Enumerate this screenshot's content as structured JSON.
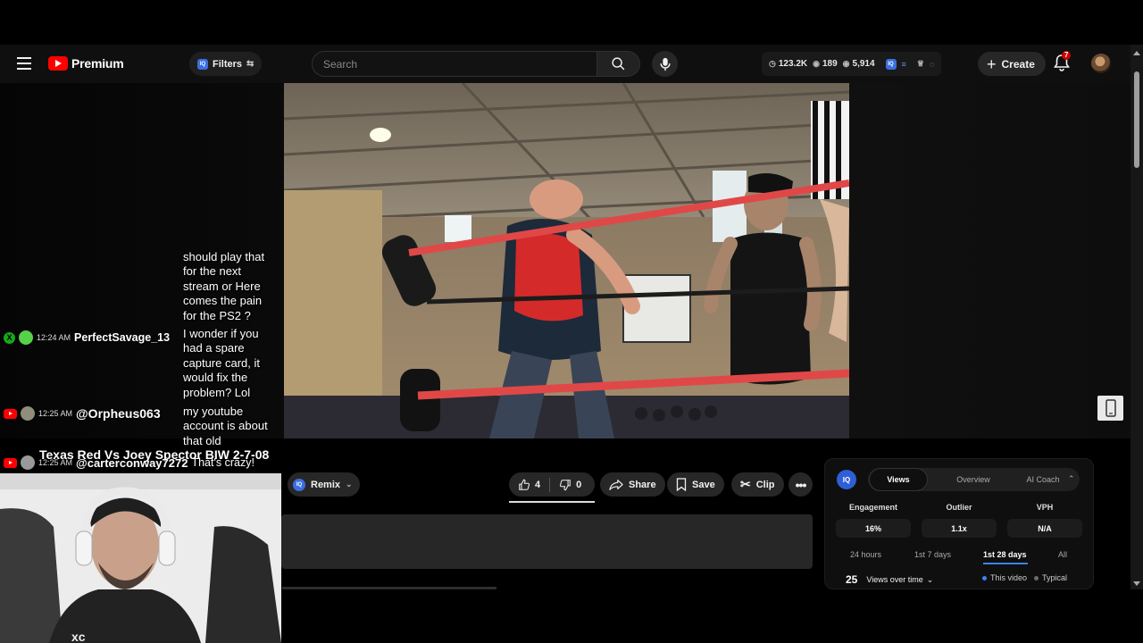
{
  "header": {
    "logo_text": "Premium",
    "filters_label": "Filters",
    "search_placeholder": "Search",
    "stats": {
      "views": "123.2K",
      "likes": "189",
      "watching": "5,914"
    },
    "create_label": "Create",
    "notification_count": "7"
  },
  "chat": {
    "messages": [
      {
        "time": "",
        "user": "",
        "text_lines": [
          "should play that",
          "for the next",
          "stream or Here",
          "comes the pain",
          "for the PS2 ?"
        ]
      },
      {
        "time": "12:24 AM",
        "user": "PerfectSavage_13",
        "text_lines": [
          "I wonder if you",
          "had a spare",
          "capture card, it",
          "would fix the",
          "problem? Lol"
        ]
      },
      {
        "time": "12:25 AM",
        "user": "@Orpheus063",
        "text_lines": [
          "my youtube",
          "account is about",
          "that old"
        ]
      },
      {
        "time": "12:25 AM",
        "user": "@carterconway7272",
        "text_lines": [
          "That's crazy!"
        ]
      }
    ]
  },
  "video": {
    "overlay_title": "Texas Red Vs Joey Spector BIW 2-7-08"
  },
  "actions": {
    "remix_label": "Remix",
    "like_count": "4",
    "dislike_count": "0",
    "share_label": "Share",
    "save_label": "Save",
    "clip_label": "Clip"
  },
  "vidiq": {
    "logo": "IQ",
    "tabs": [
      "Views",
      "Overview",
      "AI Coach"
    ],
    "active_tab": "Views",
    "metrics": [
      {
        "label": "Engagement",
        "value": "16%"
      },
      {
        "label": "Outlier",
        "value": "1.1x"
      },
      {
        "label": "VPH",
        "value": "N/A"
      }
    ],
    "ranges": [
      "24 hours",
      "1st 7 days",
      "1st 28 days",
      "All"
    ],
    "active_range": "1st 28 days",
    "views_count": "25",
    "views_over_time_label": "Views over time",
    "legend": [
      "This video",
      "Typical"
    ],
    "colors": {
      "this_video": "#3b82f6",
      "typical": "#6b6b6b"
    }
  },
  "colors": {
    "brand_red": "#ff0000",
    "iq_blue": "#2f5fd6",
    "notif_red": "#cc0000"
  }
}
